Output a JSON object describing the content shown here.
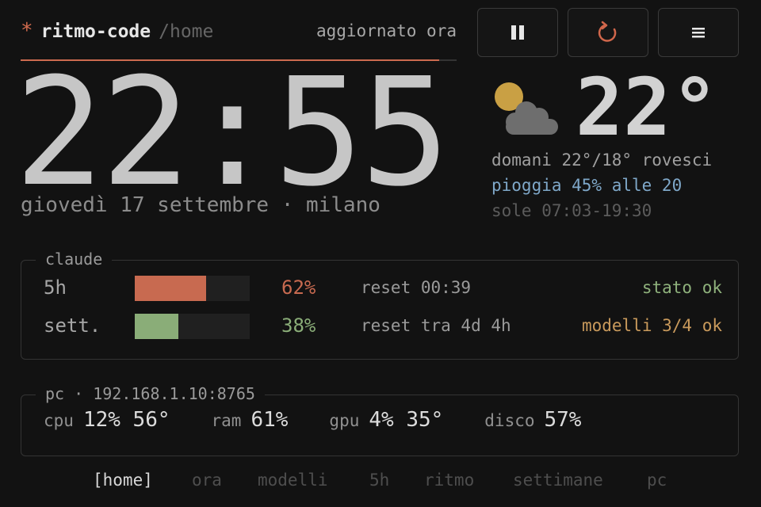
{
  "header": {
    "asterisk": "*",
    "app_name": "ritmo-code",
    "path": "/home",
    "updated": "aggiornato ora"
  },
  "buttons": {
    "pause_icon": "pause-icon",
    "refresh_icon": "refresh-icon",
    "menu_icon": "menu-icon"
  },
  "clock": {
    "time": "22:55",
    "date": "giovedì 17 settembre · milano"
  },
  "weather": {
    "icon": "partly-cloudy-icon",
    "temp": "22°",
    "tomorrow": "domani 22°/18° rovesci",
    "rain": "pioggia 45% alle 20",
    "sun": "sole 07:03-19:30"
  },
  "claude": {
    "title": "claude",
    "rows": [
      {
        "label": "5h",
        "fraction": 0.62,
        "pct": "62%",
        "reset": "reset 00:39",
        "status": "stato ok",
        "color": "#c86a50",
        "status_color": "#8fb27c"
      },
      {
        "label": "sett.",
        "fraction": 0.38,
        "pct": "38%",
        "reset": "reset tra 4d 4h",
        "status": "modelli 3/4 ok",
        "color": "#8aad78",
        "status_color": "#c99a5c"
      }
    ]
  },
  "pc": {
    "title": "pc · 192.168.1.10:8765",
    "stats": [
      {
        "key": "cpu",
        "value": "12% 56°"
      },
      {
        "key": "ram",
        "value": "61%"
      },
      {
        "key": "gpu",
        "value": "4% 35°"
      },
      {
        "key": "disco",
        "value": "57%"
      }
    ]
  },
  "nav": {
    "items": [
      "[home]",
      "ora",
      "modelli",
      "5h",
      "ritmo",
      "settimane",
      "pc"
    ],
    "active": 0
  },
  "colors": {
    "accent": "#cc6a4f",
    "bg": "#121212"
  }
}
